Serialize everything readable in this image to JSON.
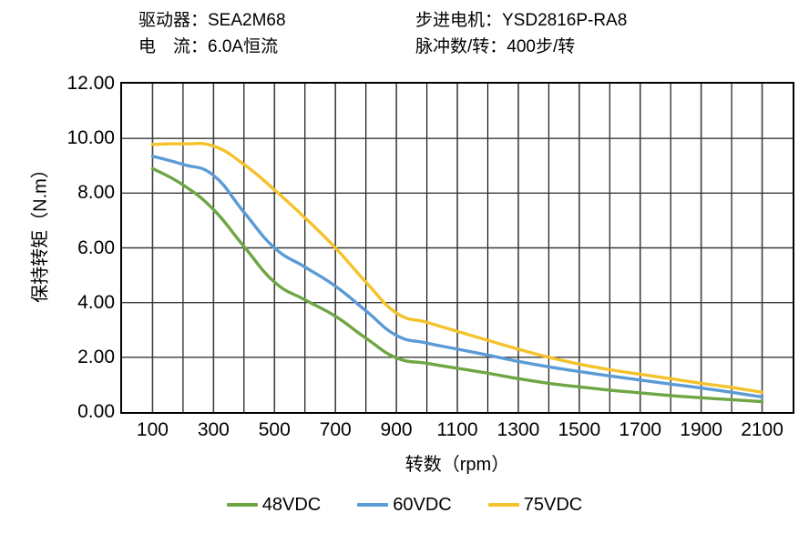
{
  "header": {
    "rows": [
      {
        "left": "驱动器：SEA2M68",
        "right": "步进电机：YSD2816P-RA8"
      },
      {
        "left": "电　流：6.0A恒流",
        "right": "脉冲数/转：400步/转"
      }
    ]
  },
  "legend": {
    "items": [
      {
        "label": "48VDC",
        "color": "#6FA644"
      },
      {
        "label": "60VDC",
        "color": "#5B9BD5"
      },
      {
        "label": "75VDC",
        "color": "#F5C22B"
      }
    ]
  },
  "chart_data": {
    "type": "line",
    "title": "",
    "xlabel": "转数（rpm）",
    "ylabel": "保持转矩（N.m）",
    "xlim": [
      0,
      2200
    ],
    "ylim": [
      0,
      12
    ],
    "ytick_step": 2,
    "ytick_labels": [
      "0.00",
      "2.00",
      "4.00",
      "6.00",
      "8.00",
      "10.00",
      "12.00"
    ],
    "ytick_values": [
      0,
      2,
      4,
      6,
      8,
      10,
      12
    ],
    "xtick_labels": [
      "100",
      "300",
      "500",
      "700",
      "900",
      "1100",
      "1300",
      "1500",
      "1700",
      "1900",
      "2100"
    ],
    "xtick_values": [
      100,
      300,
      500,
      700,
      900,
      1100,
      1300,
      1500,
      1700,
      1900,
      2100
    ],
    "grid": true,
    "grid_x_step": 100,
    "grid_y_step": 2,
    "legend_position": "bottom",
    "x": [
      100,
      200,
      300,
      400,
      500,
      600,
      700,
      800,
      900,
      1000,
      1100,
      1200,
      1300,
      1400,
      1500,
      1600,
      1700,
      1800,
      1900,
      2000,
      2100
    ],
    "series": [
      {
        "name": "48VDC",
        "color": "#6FA644",
        "values": [
          8.9,
          8.3,
          7.4,
          6.05,
          4.75,
          4.1,
          3.5,
          2.7,
          1.98,
          1.78,
          1.6,
          1.42,
          1.22,
          1.05,
          0.92,
          0.8,
          0.7,
          0.6,
          0.52,
          0.45,
          0.38
        ]
      },
      {
        "name": "60VDC",
        "color": "#5B9BD5",
        "values": [
          9.35,
          9.05,
          8.65,
          7.3,
          6.0,
          5.3,
          4.6,
          3.7,
          2.8,
          2.52,
          2.3,
          2.08,
          1.85,
          1.65,
          1.48,
          1.32,
          1.17,
          1.02,
          0.88,
          0.72,
          0.55
        ]
      },
      {
        "name": "75VDC",
        "color": "#F5C22B",
        "values": [
          9.78,
          9.8,
          9.72,
          9.05,
          8.12,
          7.1,
          6.0,
          4.75,
          3.62,
          3.28,
          2.95,
          2.62,
          2.3,
          2.0,
          1.75,
          1.55,
          1.38,
          1.22,
          1.05,
          0.9,
          0.72
        ]
      }
    ]
  }
}
